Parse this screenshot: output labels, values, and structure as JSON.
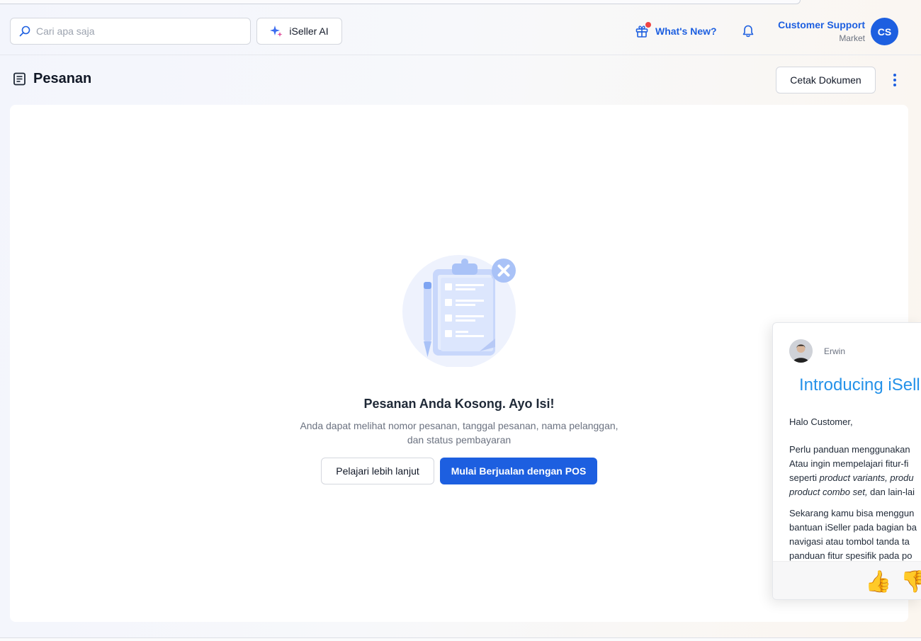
{
  "header": {
    "search_placeholder": "Cari apa saja",
    "ai_button": "iSeller AI",
    "whats_new": "What's New?",
    "user_name": "Customer Support",
    "user_store": "Market",
    "avatar_initials": "CS"
  },
  "page": {
    "title": "Pesanan",
    "print_button": "Cetak Dokumen"
  },
  "empty_state": {
    "title": "Pesanan Anda Kosong. Ayo Isi!",
    "desc_line1": "Anda dapat melihat nomor pesanan, tanggal pesanan, nama pelanggan,",
    "desc_line2": "dan status pembayaran",
    "learn_button": "Pelajari lebih lanjut",
    "pos_button": "Mulai Berjualan dengan POS"
  },
  "chat": {
    "agent_name": "Erwin",
    "title": "Introducing iSell",
    "greeting": "Halo Customer,",
    "p2_l1": "Perlu panduan menggunakan",
    "p2_l2": "Atau ingin mempelajari fitur-fi",
    "p2_l3_a": "seperti ",
    "p2_l3_b": "product variants, produ",
    "p2_l4_a": "product combo set,",
    "p2_l4_b": " dan lain-lai",
    "p3_l1": "Sekarang kamu bisa menggun",
    "p3_l2": "bantuan iSeller pada bagian ba",
    "p3_l3": "navigasi atau tombol tanda ta",
    "p3_l4": "panduan fitur spesifik pada po",
    "thumb_up": "👍",
    "thumb_down": "👎"
  },
  "colors": {
    "accent": "#1d5fe0",
    "chat_title": "#2592e9",
    "notification_dot": "#ef4444"
  }
}
